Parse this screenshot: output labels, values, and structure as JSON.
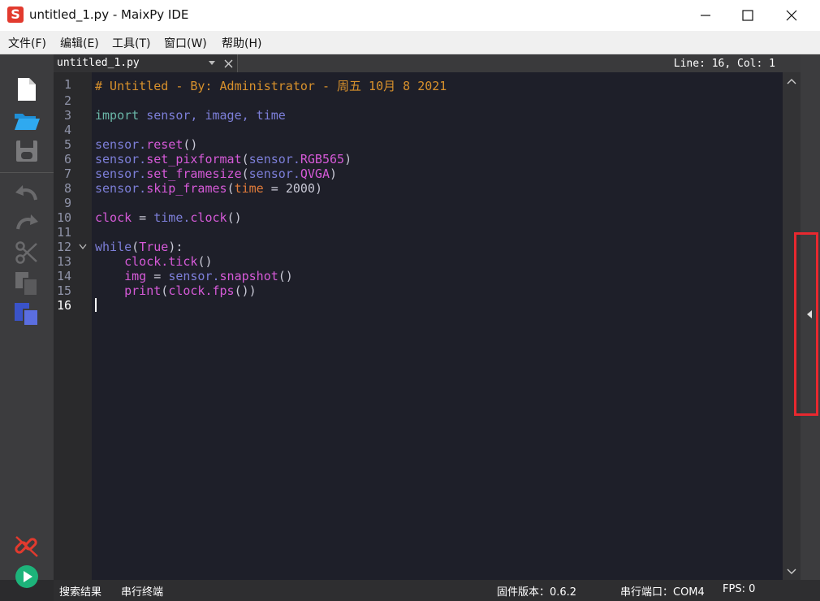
{
  "window": {
    "app_icon": "S",
    "title": "untitled_1.py - MaixPy IDE"
  },
  "menu": [
    "文件(F)",
    "编辑(E)",
    "工具(T)",
    "窗口(W)",
    "帮助(H)"
  ],
  "tab": {
    "name": "untitled_1.py"
  },
  "cursor_status": "Line: 16, Col: 1",
  "line_numbers": [
    "1",
    "2",
    "3",
    "4",
    "5",
    "6",
    "7",
    "8",
    "9",
    "10",
    "11",
    "12",
    "13",
    "14",
    "15",
    "16"
  ],
  "code": {
    "l1": "# Untitled - By: Administrator - 周五 10月 8 2021",
    "l3_kw": "import",
    "l3_rest": "sensor, image, time",
    "l5_mod": "sensor.",
    "l5_fn": "reset",
    "l5_tail": "()",
    "l6_mod": "sensor.",
    "l6_fn": "set_pixformat",
    "l6_arg_mod": "sensor.",
    "l6_arg_attr": "RGB565",
    "l7_mod": "sensor.",
    "l7_fn": "set_framesize",
    "l7_arg_mod": "sensor.",
    "l7_arg_attr": "QVGA",
    "l8_mod": "sensor.",
    "l8_fn": "skip_frames",
    "l8_param": "time",
    "l8_eq": " = ",
    "l8_val": "2000",
    "l10_a": "clock",
    "l10_b": " = ",
    "l10_mod": "time.",
    "l10_fn": "clock",
    "l12_kw": "while",
    "l12_arg": "True",
    "l13_a": "clock.",
    "l13_fn": "tick",
    "l14_a": "img",
    "l14_b": " = ",
    "l14_mod": "sensor.",
    "l14_fn": "snapshot",
    "l15_fn": "print",
    "l15_a": "clock.",
    "l15_fn2": "fps"
  },
  "status": {
    "search_results": "搜索结果",
    "serial_terminal": "串行终端",
    "firmware": "固件版本：0.6.2",
    "serial_port": "串行端口：COM4",
    "fps": "FPS: 0"
  },
  "colors": {
    "editor_bg": "#1e1f29",
    "comment": "#d8912c",
    "keyword": "#6ab7a8",
    "module": "#7d7fd9",
    "attribute": "#d65ad8",
    "highlight_box": "#e8282f",
    "run_button": "#1db37a",
    "connect_button": "#e23a2e"
  }
}
